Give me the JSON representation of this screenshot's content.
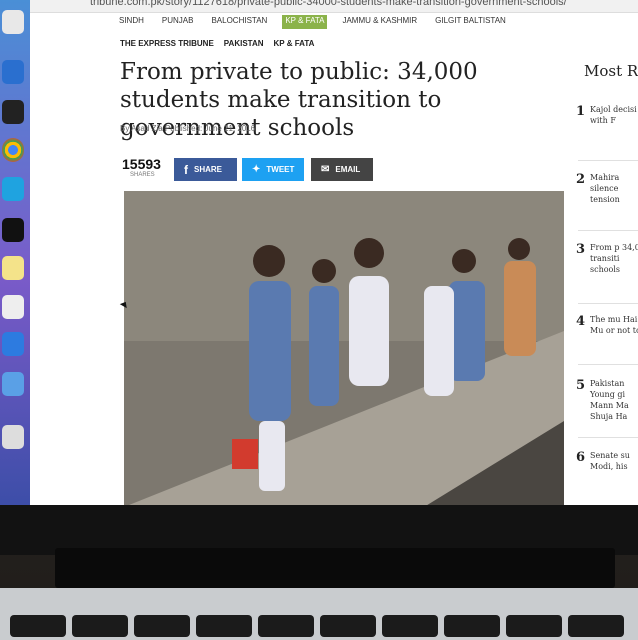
{
  "browser": {
    "url": "tribune.com.pk/story/1127618/private-public-34000-students-make-transition-government-schools/"
  },
  "subnav": [
    {
      "label": "SINDH",
      "active": false
    },
    {
      "label": "PUNJAB",
      "active": false
    },
    {
      "label": "BALOCHISTAN",
      "active": false
    },
    {
      "label": "KP & FATA",
      "active": true
    },
    {
      "label": "JAMMU & KASHMIR",
      "active": false
    },
    {
      "label": "GILGIT BALTISTAN",
      "active": false
    }
  ],
  "breadcrumbs": [
    "THE EXPRESS TRIBUNE",
    "PAKISTAN",
    "KP & FATA"
  ],
  "article": {
    "headline": "From private to public: 34,000 students make transition to government schools",
    "byline": "By Asad Zia  Published: June 21, 2016"
  },
  "share": {
    "count": "15593",
    "count_label": "SHARES",
    "facebook": "SHARE",
    "twitter": "TWEET",
    "email": "EMAIL",
    "colors": {
      "facebook": "#3b5a99",
      "twitter": "#1da1f2",
      "email": "#444444"
    }
  },
  "sidebar": {
    "title": "Most R",
    "items": [
      {
        "num": "1",
        "text": "Kajol decisi with F"
      },
      {
        "num": "2",
        "text": "Mahira silence tension"
      },
      {
        "num": "3",
        "text": "From p 34,000 transiti schools"
      },
      {
        "num": "4",
        "text": "The mu Hai Mu or not to"
      },
      {
        "num": "5",
        "text": "Pakistan Young gi Mann Ma Shuja Ha"
      },
      {
        "num": "6",
        "text": "Senate su Modi, his"
      }
    ]
  },
  "colors": {
    "active_tab": "#8bb34a"
  }
}
